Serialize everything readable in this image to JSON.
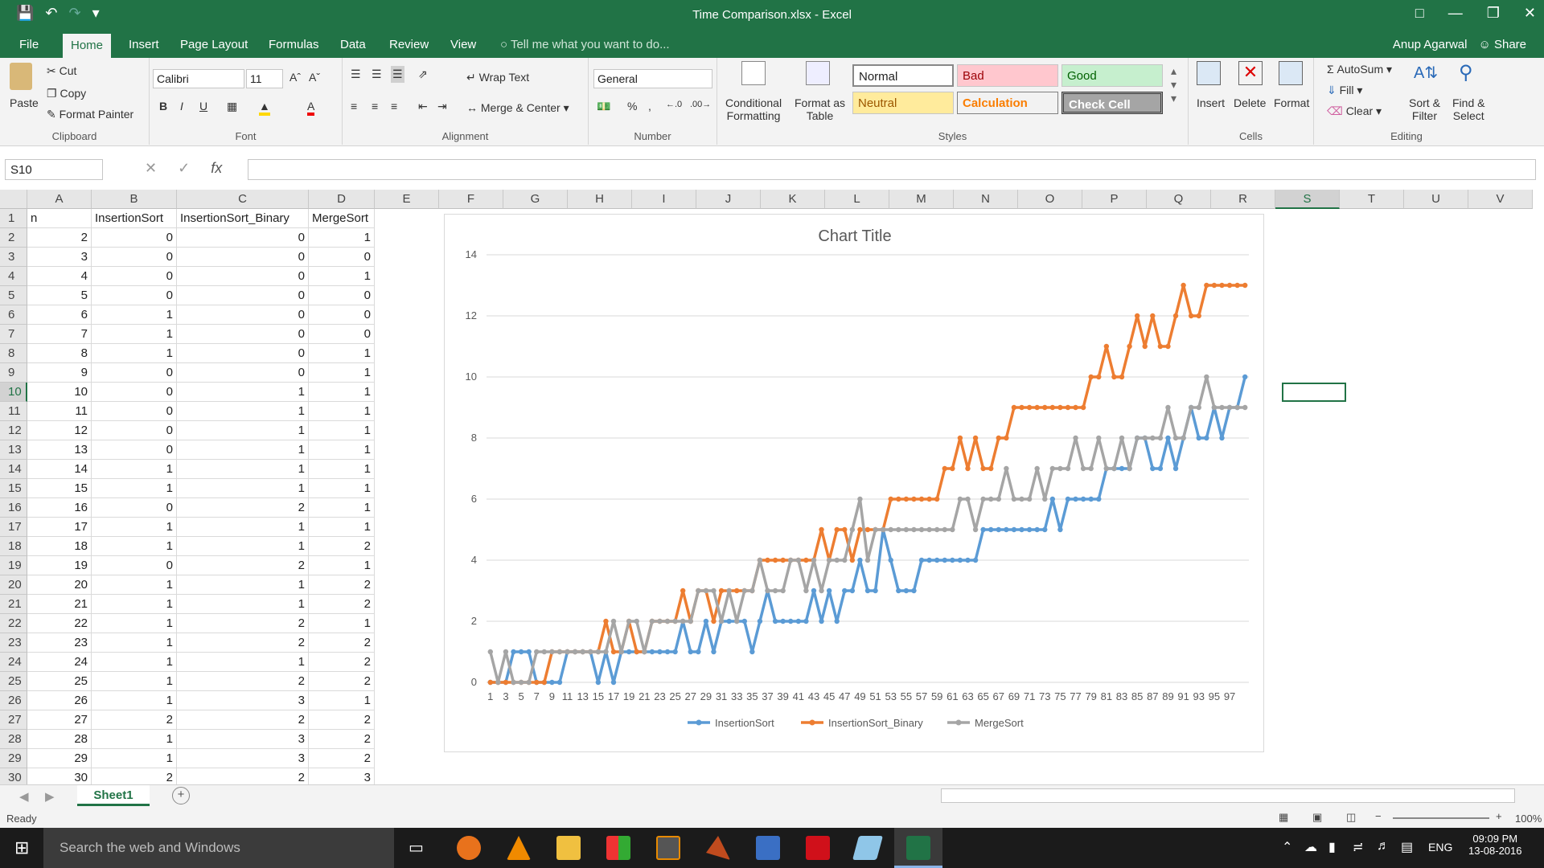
{
  "window": {
    "title": "Time Comparison.xlsx - Excel"
  },
  "tabs": [
    "File",
    "Home",
    "Insert",
    "Page Layout",
    "Formulas",
    "Data",
    "Review",
    "View"
  ],
  "tell_me": "Tell me what you want to do...",
  "account": {
    "user": "Anup Agarwal",
    "share": "Share"
  },
  "ribbon": {
    "clipboard": {
      "paste": "Paste",
      "cut": "Cut",
      "copy": "Copy",
      "format_painter": "Format Painter",
      "label": "Clipboard"
    },
    "font": {
      "name": "Calibri",
      "size": "11",
      "label": "Font"
    },
    "alignment": {
      "wrap": "Wrap Text",
      "merge": "Merge & Center",
      "label": "Alignment"
    },
    "number": {
      "format": "General",
      "label": "Number"
    },
    "styles": {
      "conditional": "Conditional",
      "formatting": "Formatting",
      "format_as": "Format as",
      "table": "Table",
      "normal": "Normal",
      "bad": "Bad",
      "good": "Good",
      "neutral": "Neutral",
      "calculation": "Calculation",
      "check": "Check Cell",
      "label": "Styles"
    },
    "cells": {
      "insert": "Insert",
      "delete": "Delete",
      "format": "Format",
      "label": "Cells"
    },
    "editing": {
      "autosum": "AutoSum",
      "fill": "Fill",
      "clear": "Clear",
      "sort": "Sort &",
      "filter": "Filter",
      "find": "Find &",
      "select": "Select",
      "label": "Editing"
    }
  },
  "namebox": "S10",
  "columns": [
    "A",
    "B",
    "C",
    "D",
    "E",
    "F",
    "G",
    "H",
    "I",
    "J",
    "K",
    "L",
    "M",
    "N",
    "O",
    "P",
    "Q",
    "R",
    "S",
    "T",
    "U",
    "V"
  ],
  "headers": [
    "n",
    "InsertionSort",
    "InsertionSort_Binary",
    "MergeSort"
  ],
  "rows": [
    [
      2,
      0,
      0,
      1
    ],
    [
      3,
      0,
      0,
      0
    ],
    [
      4,
      0,
      0,
      1
    ],
    [
      5,
      0,
      0,
      0
    ],
    [
      6,
      1,
      0,
      0
    ],
    [
      7,
      1,
      0,
      0
    ],
    [
      8,
      1,
      0,
      1
    ],
    [
      9,
      0,
      0,
      1
    ],
    [
      10,
      0,
      1,
      1
    ],
    [
      11,
      0,
      1,
      1
    ],
    [
      12,
      0,
      1,
      1
    ],
    [
      13,
      0,
      1,
      1
    ],
    [
      14,
      1,
      1,
      1
    ],
    [
      15,
      1,
      1,
      1
    ],
    [
      16,
      0,
      2,
      1
    ],
    [
      17,
      1,
      1,
      1
    ],
    [
      18,
      1,
      1,
      2
    ],
    [
      19,
      0,
      2,
      1
    ],
    [
      20,
      1,
      1,
      2
    ],
    [
      21,
      1,
      1,
      2
    ],
    [
      22,
      1,
      2,
      1
    ],
    [
      23,
      1,
      2,
      2
    ],
    [
      24,
      1,
      1,
      2
    ],
    [
      25,
      1,
      2,
      2
    ],
    [
      26,
      1,
      3,
      1
    ],
    [
      27,
      2,
      2,
      2
    ],
    [
      28,
      1,
      3,
      2
    ],
    [
      29,
      1,
      3,
      2
    ],
    [
      30,
      2,
      2,
      3
    ]
  ],
  "sheet": {
    "name": "Sheet1"
  },
  "status": {
    "ready": "Ready",
    "zoom": "100%"
  },
  "taskbar": {
    "search": "Search the web and Windows",
    "lang": "ENG",
    "time": "09:09 PM",
    "date": "13-08-2016"
  },
  "chart_data": {
    "type": "line",
    "title": "Chart Title",
    "ylim": [
      0,
      14
    ],
    "yticks": [
      0,
      2,
      4,
      6,
      8,
      10,
      12,
      14
    ],
    "x": [
      1,
      2,
      3,
      4,
      5,
      6,
      7,
      8,
      9,
      10,
      11,
      12,
      13,
      14,
      15,
      16,
      17,
      18,
      19,
      20,
      21,
      22,
      23,
      24,
      25,
      26,
      27,
      28,
      29,
      30,
      31,
      32,
      33,
      34,
      35,
      36,
      37,
      38,
      39,
      40,
      41,
      42,
      43,
      44,
      45,
      46,
      47,
      48,
      49,
      50,
      51,
      52,
      53,
      54,
      55,
      56,
      57,
      58,
      59,
      60,
      61,
      62,
      63,
      64,
      65,
      66,
      67,
      68,
      69,
      70,
      71,
      72,
      73,
      74,
      75,
      76,
      77,
      78,
      79,
      80,
      81,
      82,
      83,
      84,
      85,
      86,
      87,
      88,
      89,
      90,
      91,
      92,
      93,
      94,
      95,
      96,
      97,
      98,
      99
    ],
    "xtick_labels": [
      "1",
      "3",
      "5",
      "7",
      "9",
      "11",
      "13",
      "15",
      "17",
      "19",
      "21",
      "23",
      "25",
      "27",
      "29",
      "31",
      "33",
      "35",
      "37",
      "39",
      "41",
      "43",
      "45",
      "47",
      "49",
      "51",
      "53",
      "55",
      "57",
      "59",
      "61",
      "63",
      "65",
      "67",
      "69",
      "71",
      "73",
      "75",
      "77",
      "79",
      "81",
      "83",
      "85",
      "87",
      "89",
      "91",
      "93",
      "95",
      "97"
    ],
    "legend": "bottom",
    "series": [
      {
        "name": "InsertionSort",
        "color": "#5b9bd5",
        "values": [
          0,
          0,
          0,
          1,
          1,
          1,
          0,
          0,
          0,
          0,
          1,
          1,
          1,
          1,
          0,
          1,
          0,
          1,
          1,
          1,
          1,
          1,
          1,
          1,
          1,
          2,
          1,
          1,
          2,
          1,
          2,
          2,
          2,
          2,
          1,
          2,
          3,
          2,
          2,
          2,
          2,
          2,
          3,
          2,
          3,
          2,
          3,
          3,
          4,
          3,
          3,
          5,
          4,
          3,
          3,
          3,
          4,
          4,
          4,
          4,
          4,
          4,
          4,
          4,
          5,
          5,
          5,
          5,
          5,
          5,
          5,
          5,
          5,
          6,
          5,
          6,
          6,
          6,
          6,
          6,
          7,
          7,
          7,
          7,
          8,
          8,
          7,
          7,
          8,
          7,
          8,
          9,
          8,
          8,
          9,
          8,
          9,
          9,
          10
        ]
      },
      {
        "name": "InsertionSort_Binary",
        "color": "#ed7d31",
        "values": [
          0,
          0,
          0,
          0,
          0,
          0,
          0,
          0,
          1,
          1,
          1,
          1,
          1,
          1,
          1,
          2,
          1,
          1,
          2,
          1,
          1,
          2,
          2,
          2,
          2,
          3,
          2,
          3,
          3,
          2,
          3,
          3,
          3,
          3,
          3,
          4,
          4,
          4,
          4,
          4,
          4,
          4,
          4,
          5,
          4,
          5,
          5,
          4,
          5,
          5,
          5,
          5,
          6,
          6,
          6,
          6,
          6,
          6,
          6,
          7,
          7,
          8,
          7,
          8,
          7,
          7,
          8,
          8,
          9,
          9,
          9,
          9,
          9,
          9,
          9,
          9,
          9,
          9,
          10,
          10,
          11,
          10,
          10,
          11,
          12,
          11,
          12,
          11,
          11,
          12,
          13,
          12,
          12,
          13,
          13,
          13,
          13,
          13,
          13
        ]
      },
      {
        "name": "MergeSort",
        "color": "#a5a5a5",
        "values": [
          1,
          0,
          1,
          0,
          0,
          0,
          1,
          1,
          1,
          1,
          1,
          1,
          1,
          1,
          1,
          1,
          2,
          1,
          2,
          2,
          1,
          2,
          2,
          2,
          2,
          2,
          2,
          3,
          3,
          3,
          2,
          3,
          2,
          3,
          3,
          4,
          3,
          3,
          3,
          4,
          4,
          3,
          4,
          3,
          4,
          4,
          4,
          5,
          6,
          4,
          5,
          5,
          5,
          5,
          5,
          5,
          5,
          5,
          5,
          5,
          5,
          6,
          6,
          5,
          6,
          6,
          6,
          7,
          6,
          6,
          6,
          7,
          6,
          7,
          7,
          7,
          8,
          7,
          7,
          8,
          7,
          7,
          8,
          7,
          8,
          8,
          8,
          8,
          9,
          8,
          8,
          9,
          9,
          10,
          9,
          9,
          9,
          9,
          9
        ]
      }
    ]
  }
}
